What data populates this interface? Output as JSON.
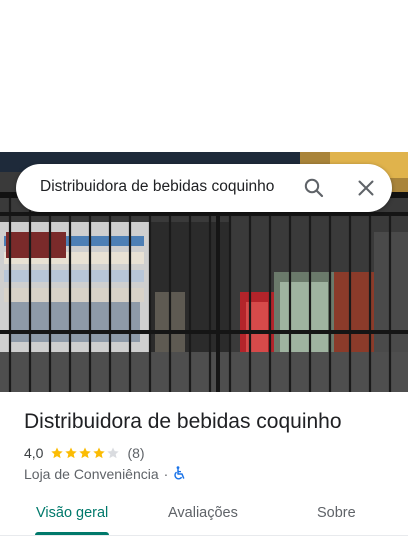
{
  "search": {
    "query": "Distribuidora de bebidas coquinho"
  },
  "place": {
    "name": "Distribuidora de bebidas coquinho",
    "rating": "4,0",
    "stars": 4,
    "reviews": "(8)",
    "category": "Loja de Conveniência",
    "separator": "·",
    "accessibility_icon": "wheelchair-icon"
  },
  "tabs": [
    {
      "label": "Visão geral",
      "active": true
    },
    {
      "label": "Avaliações",
      "active": false
    },
    {
      "label": "Sobre",
      "active": false
    }
  ],
  "colors": {
    "accent": "#00796b",
    "star": "#fbbc04",
    "accessibility": "#1a73e8"
  }
}
